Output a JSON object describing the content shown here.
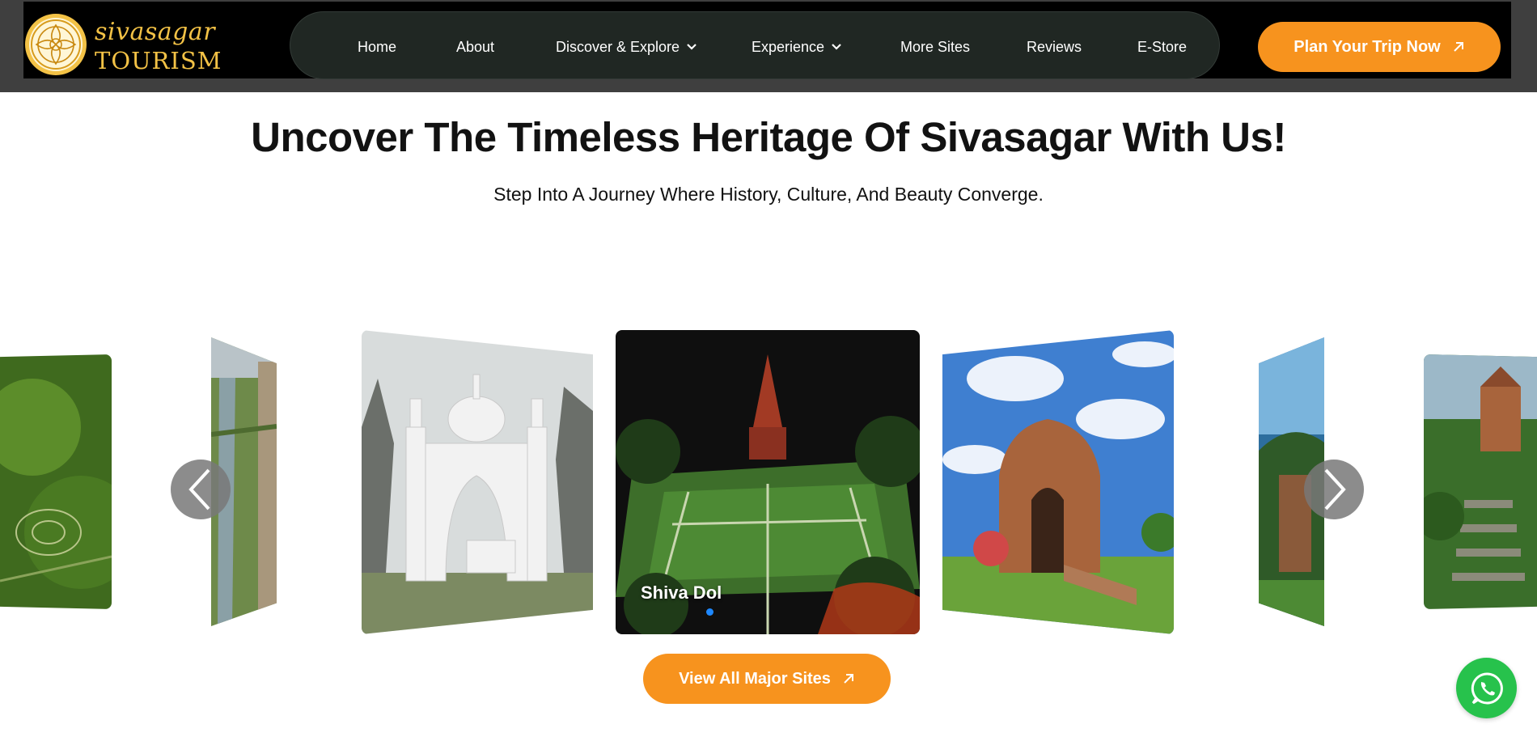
{
  "brand": {
    "line1": "sivasagar",
    "line2": "TOURISM"
  },
  "nav": {
    "items": [
      {
        "label": "Home"
      },
      {
        "label": "About"
      },
      {
        "label": "Discover & Explore"
      },
      {
        "label": "Experience"
      },
      {
        "label": "More Sites"
      },
      {
        "label": "Reviews"
      },
      {
        "label": "E-Store"
      }
    ],
    "cta": "Plan Your Trip Now"
  },
  "hero": {
    "title": "Uncover The Timeless Heritage Of Sivasagar With Us!",
    "subtitle": "Step Into A Journey Where History, Culture, And Beauty Converge."
  },
  "carousel": {
    "active_caption": "Shiva Dol",
    "slides": [
      "aerial-green-park",
      "lake-aerial",
      "white-mosque-gate",
      "shiva-dol-night",
      "brick-temple-ruin",
      "ruin-trees",
      "temple-stairway"
    ]
  },
  "view_all_label": "View All Major Sites",
  "colors": {
    "accent": "#f7931e",
    "nav_bg": "#202723",
    "whatsapp": "#27c24c",
    "dot": "#1e88ff"
  },
  "icons": {
    "prev": "chevron-left-icon",
    "next": "chevron-right-icon",
    "arrow": "arrow-up-right-icon",
    "chat": "whatsapp-icon"
  }
}
